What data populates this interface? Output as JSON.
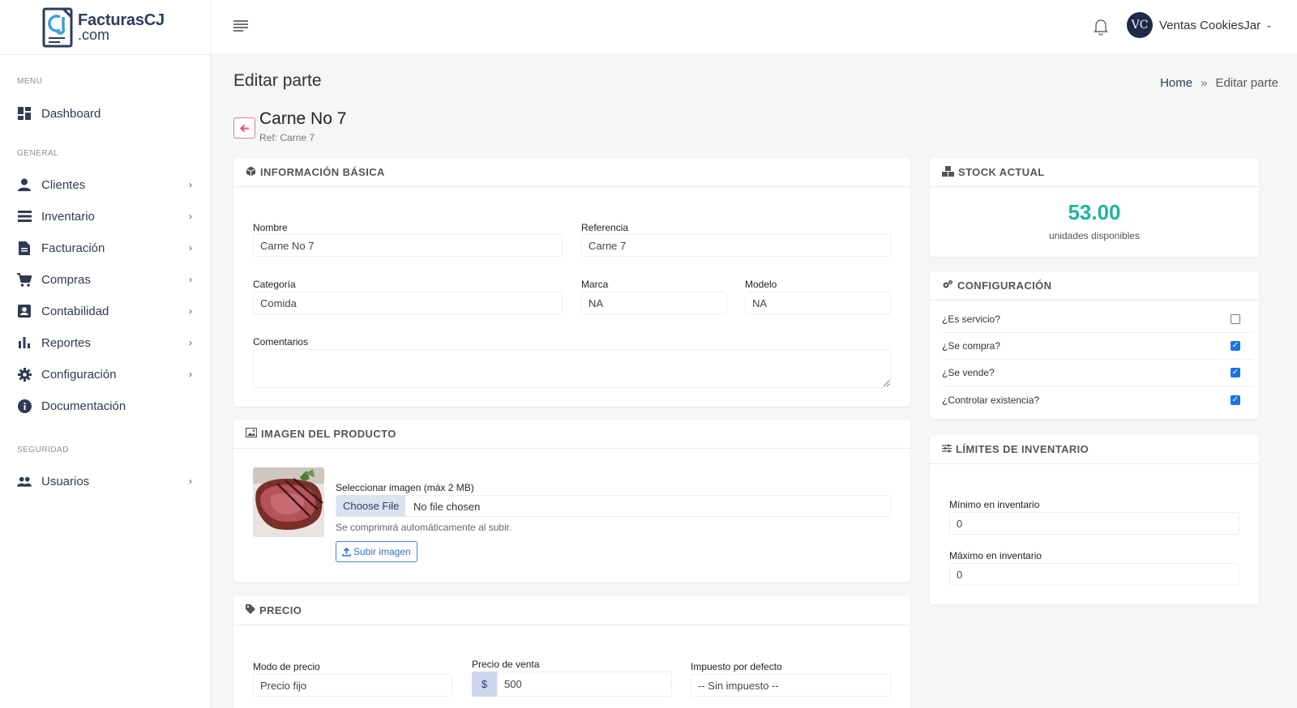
{
  "brand": {
    "line1": "FacturasCJ",
    "line2": ".com",
    "mark": "CJ"
  },
  "sidebar": {
    "sections": {
      "menu": "MENU",
      "general": "GENERAL",
      "seguridad": "SEGURIDAD"
    },
    "items": {
      "dashboard": "Dashboard",
      "clientes": "Clientes",
      "inventario": "Inventario",
      "facturacion": "Facturación",
      "compras": "Compras",
      "contabilidad": "Contabilidad",
      "reportes": "Reportes",
      "configuracion": "Configuración",
      "documentacion": "Documentación",
      "usuarios": "Usuarios"
    },
    "chevron": "›"
  },
  "topbar": {
    "user_initials": "VC",
    "user_name": "Ventas CookiesJar",
    "caret": "⌄"
  },
  "page": {
    "title": "Editar parte"
  },
  "breadcrumb": {
    "home": "Home",
    "sep": "»",
    "current": "Editar parte"
  },
  "product": {
    "name": "Carne No 7",
    "ref": "Ref: Carne 7"
  },
  "basic_info": {
    "header": "INFORMACIÓN BÁSICA",
    "nombre_label": "Nombre",
    "nombre_value": "Carne No 7",
    "referencia_label": "Referencia",
    "referencia_value": "Carne 7",
    "categoria_label": "Categoría",
    "categoria_value": "Comida",
    "marca_label": "Marca",
    "marca_value": "NA",
    "modelo_label": "Modelo",
    "modelo_value": "NA",
    "comentarios_label": "Comentarios",
    "comentarios_value": ""
  },
  "image_card": {
    "header": "IMAGEN DEL PRODUCTO",
    "select_label": "Seleccionar imagen (máx 2 MB)",
    "choose_file": "Choose File",
    "no_file": "No file chosen",
    "hint": "Se comprimirá automáticamente al subir.",
    "upload": "Subir imagen"
  },
  "price_card": {
    "header": "PRECIO",
    "modo_label": "Modo de precio",
    "modo_value": "Precio fijo",
    "venta_label": "Precio de venta",
    "currency": "$",
    "venta_value": "500",
    "impuesto_label": "Impuesto por defecto",
    "impuesto_value": "-- Sin impuesto --"
  },
  "stock_card": {
    "header": "STOCK ACTUAL",
    "value": "53.00",
    "unit": "unidades disponibles"
  },
  "config_card": {
    "header": "CONFIGURACIÓN",
    "es_servicio": "¿Es servicio?",
    "es_servicio_checked": false,
    "se_compra": "¿Se compra?",
    "se_compra_checked": true,
    "se_vende": "¿Se vende?",
    "se_vende_checked": true,
    "controlar": "¿Controlar existencia?",
    "controlar_checked": true
  },
  "limits_card": {
    "header": "LÍMITES DE INVENTARIO",
    "min_label": "Mínimo en inventario",
    "min_value": "0",
    "max_label": "Máximo en inventario",
    "max_value": "0"
  },
  "colors": {
    "accent": "#1fb5a0",
    "primary": "#1a73e8",
    "back": "#e0527f",
    "navy": "#1e2a4a"
  }
}
